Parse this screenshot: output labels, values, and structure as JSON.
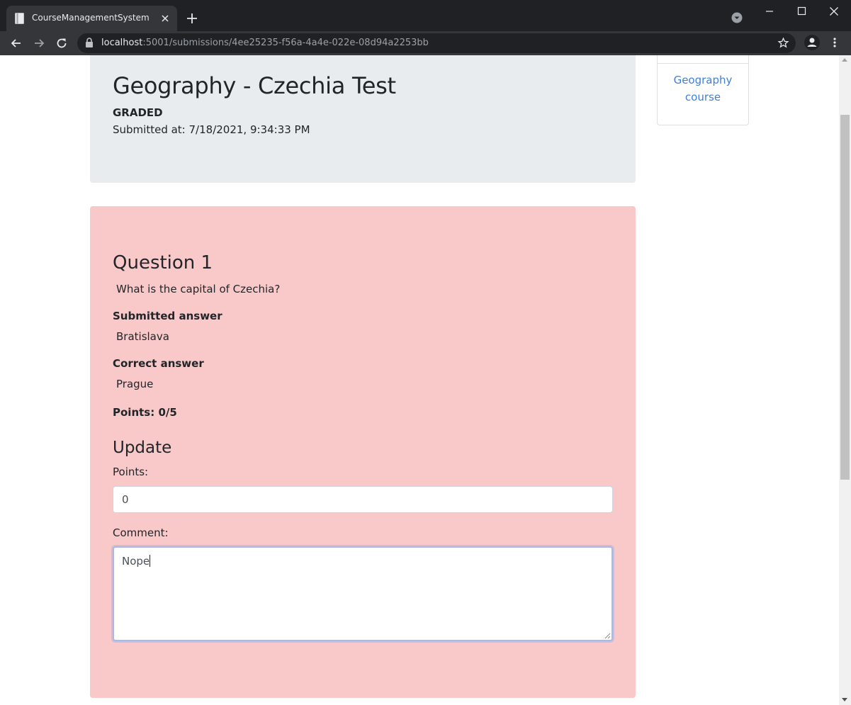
{
  "browser": {
    "tab_title": "CourseManagementSystem",
    "url_host": "localhost",
    "url_rest": ":5001/submissions/4ee25235-f56a-4a4e-022e-08d94a2253bb"
  },
  "header": {
    "title": "Geography - Czechia Test",
    "status": "GRADED",
    "submitted_at": "Submitted at: 7/18/2021, 9:34:33 PM"
  },
  "sidebar": {
    "link_line1": "Geography",
    "link_line2": "course"
  },
  "question": {
    "title": "Question 1",
    "text": "What is the capital of Czechia?",
    "submitted_label": "Submitted answer",
    "submitted_value": "Bratislava",
    "correct_label": "Correct answer",
    "correct_value": "Prague",
    "points_summary": "Points: 0/5",
    "card_color": "#f9c9c9"
  },
  "update": {
    "title": "Update",
    "points_label": "Points:",
    "points_value": "0",
    "comment_label": "Comment:",
    "comment_value": "Nope"
  },
  "icons": {
    "tab_favicon": "page-icon",
    "tab_close": "close-icon",
    "new_tab": "plus-icon",
    "back": "arrow-left-icon",
    "forward": "arrow-right-icon",
    "reload": "reload-icon",
    "lock": "lock-icon",
    "bookmark": "star-icon",
    "profile": "person-icon",
    "menu": "kebab-menu-icon"
  }
}
